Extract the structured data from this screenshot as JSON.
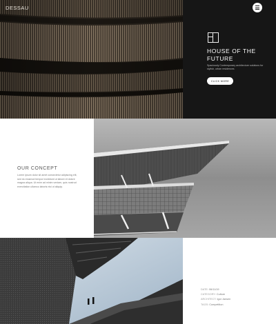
{
  "brand": {
    "name": "DESSAU"
  },
  "hero": {
    "title": "HOUSE OF THE FUTURE",
    "subtitle": "Spaciously Contemporary architecture solutions for stylish, urban residences",
    "button_label": "CLICK MORE",
    "panel_color": "#161616"
  },
  "concept": {
    "title": "OUR CONCEPT",
    "text": "Lorem ipsum dolor sit amet consectetur adipiscing elit, sed do eiusmod tempor incididunt ut labore et dolore magna aliqua. Ut enim ad minim veniam, quis nostrud exercitation ullamco laboris nisi ut aliquip."
  },
  "details": {
    "items": [
      {
        "key": "DATE",
        "value": "06/11/19"
      },
      {
        "key": "CATEGORY",
        "value": "Culture"
      },
      {
        "key": "ARCHITECT",
        "value": "Igor Jansen"
      },
      {
        "key": "TAGS",
        "value": "Competition"
      }
    ]
  },
  "colors": {
    "dark": "#161616",
    "accent_white": "#ffffff",
    "text_gray": "#777777"
  }
}
